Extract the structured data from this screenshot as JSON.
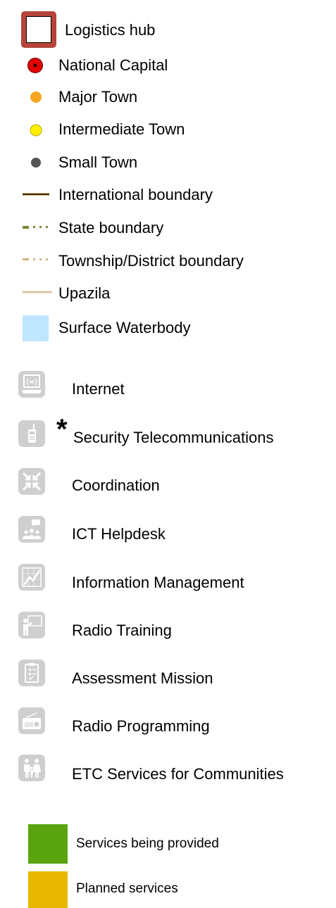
{
  "legend": {
    "map_symbols": [
      {
        "id": "logistics_hub",
        "label": "Logistics hub",
        "icon": "logistics-hub-square",
        "color": "#b5443a"
      },
      {
        "id": "national_capital",
        "label": "National Capital",
        "icon": "national-capital-dot",
        "color": "#e00000"
      },
      {
        "id": "major_town",
        "label": "Major Town",
        "icon": "major-town-dot",
        "color": "#f5a623"
      },
      {
        "id": "intermediate_town",
        "label": "Intermediate Town",
        "icon": "intermediate-town-dot",
        "color": "#ffee00"
      },
      {
        "id": "small_town",
        "label": "Small Town",
        "icon": "small-town-dot",
        "color": "#555555"
      },
      {
        "id": "international_boundary",
        "label": "International boundary",
        "icon": "solid-line",
        "color": "#3a2a10"
      },
      {
        "id": "state_boundary",
        "label": "State boundary",
        "icon": "dash-dot-line",
        "color": "#7a8a3a"
      },
      {
        "id": "township_boundary",
        "label": "Township/District boundary",
        "icon": "dash-dot-line",
        "color": "#d4b483"
      },
      {
        "id": "upazila",
        "label": "Upazila",
        "icon": "solid-line",
        "color": "#d9c4a0"
      },
      {
        "id": "surface_waterbody",
        "label": "Surface Waterbody",
        "icon": "water-swatch",
        "color": "#bfe6ff"
      }
    ],
    "services": [
      {
        "id": "internet",
        "label": "Internet",
        "icon": "internet-icon"
      },
      {
        "id": "security_telecom",
        "label": "Security Telecommunications",
        "icon": "walkie-talkie-icon",
        "marker": "*"
      },
      {
        "id": "coordination",
        "label": "Coordination",
        "icon": "coordination-icon"
      },
      {
        "id": "ict_helpdesk",
        "label": "ICT Helpdesk",
        "icon": "helpdesk-icon"
      },
      {
        "id": "information_management",
        "label": "Information Management",
        "icon": "chart-icon"
      },
      {
        "id": "radio_training",
        "label": "Radio Training",
        "icon": "training-icon"
      },
      {
        "id": "assessment_mission",
        "label": "Assessment Mission",
        "icon": "clipboard-icon"
      },
      {
        "id": "radio_programming",
        "label": "Radio Programming",
        "icon": "radio-icon"
      },
      {
        "id": "etc_communities",
        "label": "ETC Services for Communities",
        "icon": "community-icon"
      }
    ],
    "status": [
      {
        "id": "provided",
        "label": "Services being provided",
        "color": "#5aa50f"
      },
      {
        "id": "planned",
        "label": "Planned services",
        "color": "#e8b800"
      }
    ],
    "tile_color": "#cfcfcf"
  }
}
